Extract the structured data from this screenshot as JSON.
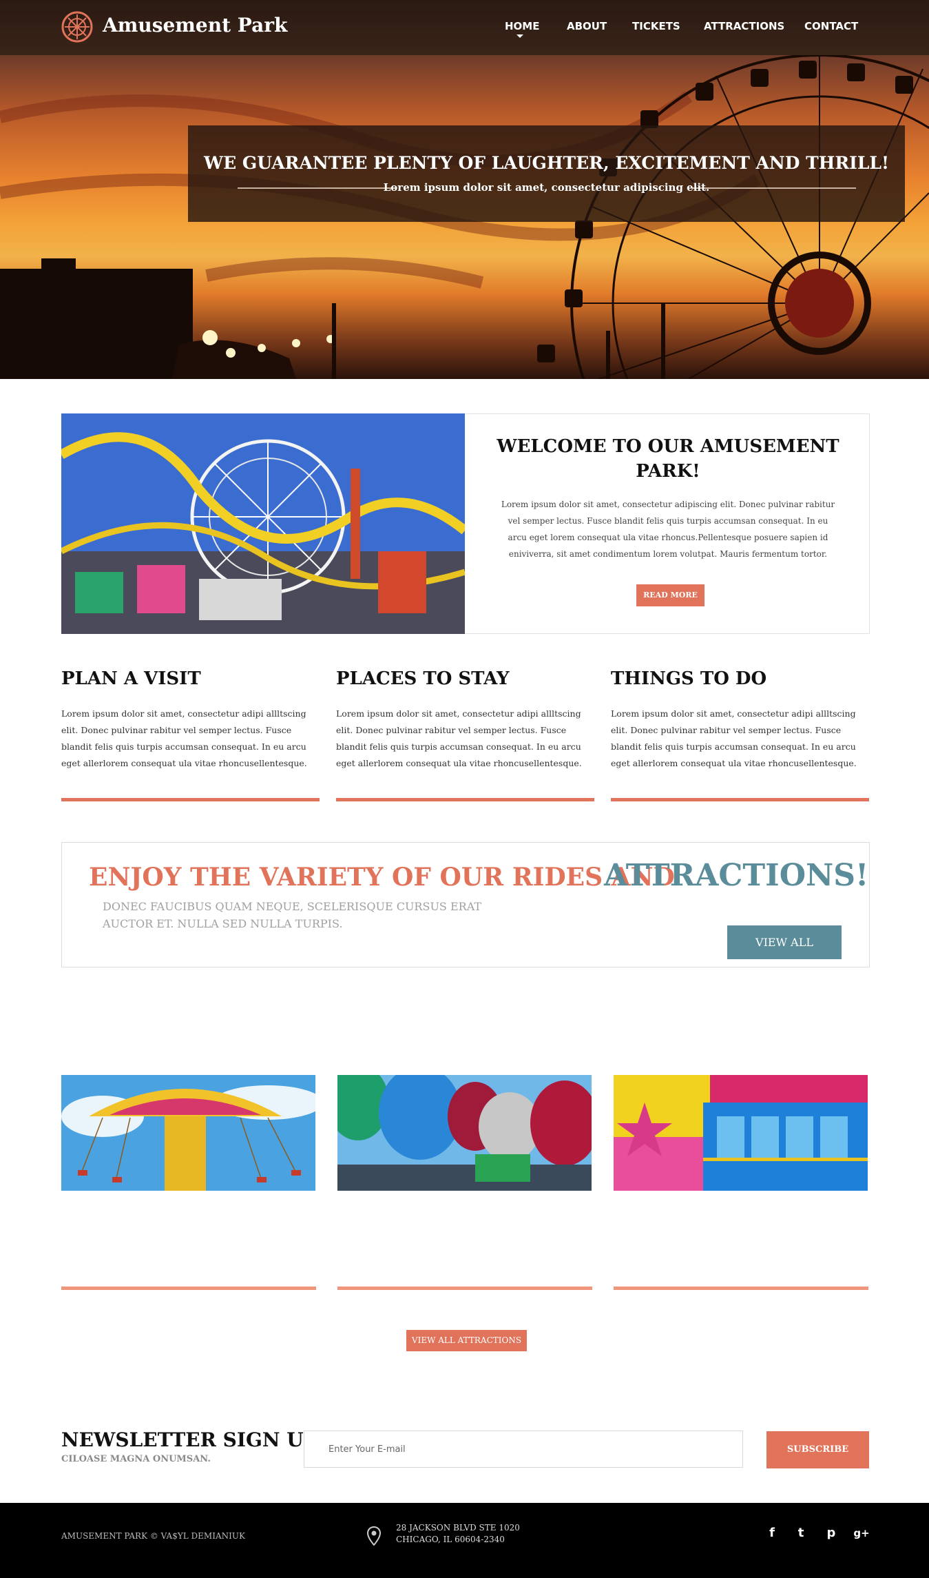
{
  "header": {
    "brand": "Amusement Park",
    "nav": [
      "HOME",
      "ABOUT",
      "TICKETS",
      "ATTRACTIONS",
      "CONTACT"
    ],
    "active_nav": "HOME"
  },
  "hero": {
    "title": "WE GUARANTEE PLENTY OF LAUGHTER, EXCITEMENT AND THRILL!",
    "subtitle": "Lorem ipsum dolor sit amet, consectetur adipiscing elit."
  },
  "welcome": {
    "title": "WELCOME TO OUR AMUSEMENT PARK!",
    "text": "Lorem ipsum dolor sit amet, consectetur adipiscing elit. Donec pulvinar rabitur vel semper lectus. Fusce blandit felis quis turpis accumsan consequat. In eu arcu eget lorem consequat ula vitae rhoncus.Pellentesque posuere sapien id eniviverra, sit amet condimentum lorem volutpat. Mauris fermentum tortor.",
    "button": "READ MORE"
  },
  "columns": [
    {
      "title": "PLAN A VISIT",
      "text": "Lorem ipsum dolor sit amet, consectetur adipi allltscing elit. Donec pulvinar rabitur vel semper lectus. Fusce blandit felis quis turpis accumsan consequat. In eu arcu eget allerlorem consequat ula vitae rhoncusellentesque."
    },
    {
      "title": "PLACES TO STAY",
      "text": "Lorem ipsum dolor sit amet, consectetur adipi allltscing elit. Donec pulvinar rabitur vel semper lectus. Fusce blandit felis quis turpis accumsan consequat. In eu arcu eget allerlorem consequat ula vitae rhoncusellentesque."
    },
    {
      "title": "THINGS TO DO",
      "text": "Lorem ipsum dolor sit amet, consectetur adipi allltscing elit. Donec pulvinar rabitur vel semper lectus. Fusce blandit felis quis turpis accumsan consequat. In eu arcu eget allerlorem consequat ula vitae rhoncusellentesque."
    }
  ],
  "enjoy": {
    "title_part1": "ENJOY THE VARIETY OF OUR RIDES AND",
    "title_part2": "ATTRACTIONS!",
    "subtitle": "DONEC FAUCIBUS QUAM NEQUE, SCELERISQUE CURSUS ERAT AUCTOR ET. NULLA SED NULLA TURPIS.",
    "button": "VIEW ALL"
  },
  "attractions": {
    "button": "VIEW ALL ATTRACTIONS"
  },
  "newsletter": {
    "title": "NEWSLETTER SIGN UP",
    "subtitle": "CILOASE MAGNA ONUMSAN.",
    "placeholder": "Enter Your E-mail",
    "button": "SUBSCRIBE"
  },
  "footer": {
    "copyright": "AMUSEMENT PARK ©   VA$YL DEMIANIUK",
    "address_line1": "28 JACKSON BLVD STE 1020",
    "address_line2": "CHICAGO, IL 60604-2340",
    "social": [
      "facebook-icon",
      "twitter-icon",
      "pinterest-icon",
      "google-plus-icon"
    ],
    "social_glyphs": [
      "f",
      "t",
      "p",
      "g+"
    ]
  },
  "colors": {
    "accent": "#e2735b",
    "teal": "#5a8c99",
    "header_bg": "#2a1a12",
    "footer_bg": "#000000"
  }
}
